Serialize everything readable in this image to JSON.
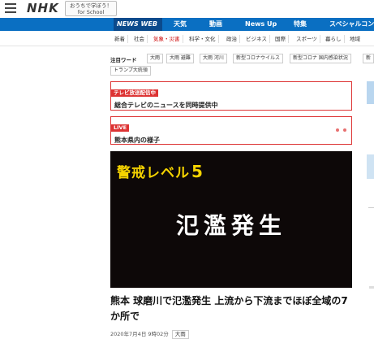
{
  "header": {
    "logo": "NHK",
    "promo_line1": "おうちで学ぼう！",
    "promo_line2": "for School"
  },
  "bluenav": {
    "items": [
      "NEWS WEB",
      "天気",
      "動画",
      "News Up",
      "特集",
      "スペシャルコン"
    ]
  },
  "catnav": {
    "items": [
      "新着",
      "社会",
      "気象・災害",
      "科学・文化",
      "政治",
      "ビジネス",
      "国際",
      "スポーツ",
      "暮らし",
      "地域"
    ],
    "selected": "気象・災害"
  },
  "keywords": {
    "label": "注目ワード",
    "items": [
      "大雨",
      "大雨 避難",
      "大雨 河川",
      "新型コロナウイルス",
      "新型コロナ 国内感染状況",
      "新",
      "トランプ大統領"
    ]
  },
  "broadcast_box": {
    "tag": "テレビ放送配信中",
    "text": "総合テレビのニュースを同時提供中"
  },
  "live_box": {
    "tag": "LIVE",
    "text": "熊本県内の様子"
  },
  "hero": {
    "level_text": "警戒レベル",
    "level_num": "5",
    "main_text": "氾濫発生"
  },
  "article": {
    "headline": "熊本 球磨川で氾濫発生 上流から下流までほぼ全域の7か所で",
    "datetime": "2020年7月4日 9時02分",
    "tag": "大雨"
  },
  "colors": {
    "nav_blue": "#0a6fc2",
    "accent_red": "#d33",
    "warning_yellow": "#f5d300"
  }
}
